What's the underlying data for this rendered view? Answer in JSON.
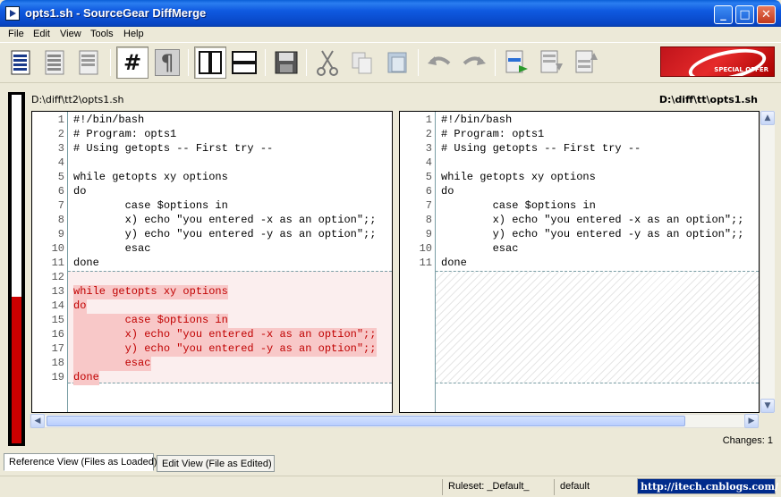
{
  "window": {
    "title": "opts1.sh - SourceGear DiffMerge",
    "min_glyph": "_",
    "max_glyph": "□",
    "close_glyph": "✕"
  },
  "menu": [
    "File",
    "Edit",
    "View",
    "Tools",
    "Help"
  ],
  "toolbar": {
    "icons": [
      "view-file-icon",
      "view-diff-icon",
      "view-merge-icon",
      "line-numbers-icon",
      "pilcrow-icon",
      "side-by-side-icon",
      "stacked-icon",
      "save-icon",
      "cut-icon",
      "copy-icon",
      "paste-icon",
      "undo-icon",
      "redo-icon",
      "next-change-icon",
      "prev-change-icon",
      "next-conflict-icon"
    ],
    "line_numbers_glyph": "#",
    "pilcrow_glyph": "¶",
    "ad_text": "SPECIAL OFFER"
  },
  "left_path": "D:\\diff\\tt2\\opts1.sh",
  "right_path": "D:\\diff\\tt\\opts1.sh",
  "left_lines": [
    {
      "n": "1",
      "t": "#!/bin/bash"
    },
    {
      "n": "2",
      "t": "# Program: opts1"
    },
    {
      "n": "3",
      "t": "# Using getopts -- First try --"
    },
    {
      "n": "4",
      "t": ""
    },
    {
      "n": "5",
      "t": "while getopts xy options"
    },
    {
      "n": "6",
      "t": "do"
    },
    {
      "n": "7",
      "t": "        case $options in"
    },
    {
      "n": "8",
      "t": "        x) echo \"you entered -x as an option\";;"
    },
    {
      "n": "9",
      "t": "        y) echo \"you entered -y as an option\";;"
    },
    {
      "n": "10",
      "t": "        esac"
    },
    {
      "n": "11",
      "t": "done"
    },
    {
      "n": "12",
      "t": ""
    },
    {
      "n": "13",
      "t": "while getopts xy options"
    },
    {
      "n": "14",
      "t": "do"
    },
    {
      "n": "15",
      "t": "        case $options in"
    },
    {
      "n": "16",
      "t": "        x) echo \"you entered -x as an option\";;"
    },
    {
      "n": "17",
      "t": "        y) echo \"you entered -y as an option\";;"
    },
    {
      "n": "18",
      "t": "        esac"
    },
    {
      "n": "19",
      "t": "done"
    }
  ],
  "right_lines": [
    {
      "n": "1",
      "t": "#!/bin/bash"
    },
    {
      "n": "2",
      "t": "# Program: opts1"
    },
    {
      "n": "3",
      "t": "# Using getopts -- First try --"
    },
    {
      "n": "4",
      "t": ""
    },
    {
      "n": "5",
      "t": "while getopts xy options"
    },
    {
      "n": "6",
      "t": "do"
    },
    {
      "n": "7",
      "t": "        case $options in"
    },
    {
      "n": "8",
      "t": "        x) echo \"you entered -x as an option\";;"
    },
    {
      "n": "9",
      "t": "        y) echo \"you entered -y as an option\";;"
    },
    {
      "n": "10",
      "t": "        esac"
    },
    {
      "n": "11",
      "t": "done"
    }
  ],
  "changes": "Changes: 1",
  "tabs": [
    "Reference View (Files as Loaded)",
    "Edit View (File as Edited)"
  ],
  "status": {
    "ruleset": "Ruleset: _Default_",
    "default": "default",
    "url": "http://itech.cnblogs.com/"
  },
  "colors": {
    "deleted_text": "#c00000",
    "deleted_bg": "#f8c8c8",
    "title_blue": "#0a5fd8"
  }
}
